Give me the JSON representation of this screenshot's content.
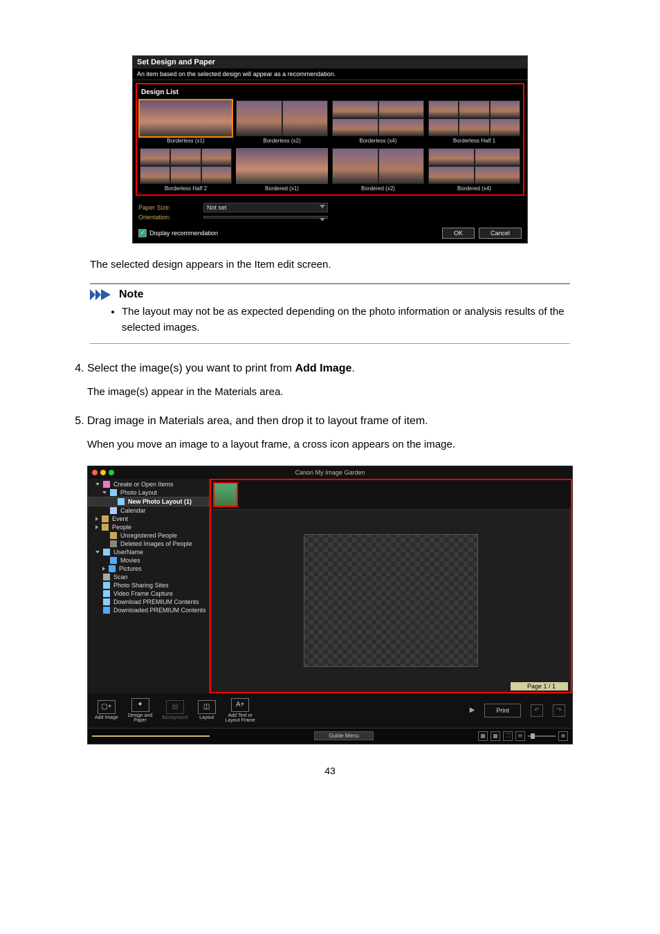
{
  "dialog": {
    "title": "Set Design and Paper",
    "subtitle": "An item based on the selected design will appear as a recommendation.",
    "design_list_header": "Design List",
    "designs": [
      {
        "label": "Borderless (x1)",
        "selected": true,
        "grid": null
      },
      {
        "label": "Borderless (x2)",
        "selected": false,
        "grid": "g2x1"
      },
      {
        "label": "Borderless (x4)",
        "selected": false,
        "grid": "g2x2"
      },
      {
        "label": "Borderless Half 1",
        "selected": false,
        "grid": "g3x2"
      },
      {
        "label": "Borderless Half 2",
        "selected": false,
        "grid": "g3x2"
      },
      {
        "label": "Bordered (x1)",
        "selected": false,
        "grid": null
      },
      {
        "label": "Bordered (x2)",
        "selected": false,
        "grid": "g2x1"
      },
      {
        "label": "Bordered (x4)",
        "selected": false,
        "grid": "g2x2"
      }
    ],
    "paper_size_label": "Paper Size:",
    "paper_size_value": "Not set",
    "orientation_label": "Orientation:",
    "orientation_value": "",
    "display_recommendation": "Display recommendation",
    "ok": "OK",
    "cancel": "Cancel"
  },
  "instructions": {
    "after_dialog": "The selected design appears in the Item edit screen.",
    "note_heading": "Note",
    "note_bullet": "The layout may not be as expected depending on the photo information or analysis results of the selected images.",
    "step4_pre": "Select the image(s) you want to print from ",
    "step4_bold": "Add Image",
    "step4_post": ".",
    "step4_sub": "The image(s) appear in the Materials area.",
    "step5": "Drag image in Materials area, and then drop it to layout frame of item.",
    "step5_sub": "When you move an image to a layout frame, a cross icon appears on the image."
  },
  "app": {
    "title": "Canon My Image Garden",
    "page_indicator": "Page 1 / 1",
    "sidebar": [
      {
        "label": "Create or Open Items",
        "indent": 0,
        "icon": "brush",
        "caret": "open"
      },
      {
        "label": "Photo Layout",
        "indent": 1,
        "icon": "grid",
        "caret": "open"
      },
      {
        "label": "New Photo Layout (1)",
        "indent": 2,
        "icon": "grid",
        "selected": true
      },
      {
        "label": "Calendar",
        "indent": 1,
        "icon": "calendar"
      },
      {
        "label": "Event",
        "indent": 0,
        "icon": "clock",
        "caret": "closed"
      },
      {
        "label": "People",
        "indent": 0,
        "icon": "person",
        "caret": "closed"
      },
      {
        "label": "Unregistered People",
        "indent": 1,
        "icon": "person"
      },
      {
        "label": "Deleted Images of People",
        "indent": 1,
        "icon": "person-x"
      },
      {
        "label": "UserName",
        "indent": 0,
        "icon": "computer",
        "caret": "open"
      },
      {
        "label": "Movies",
        "indent": 1,
        "icon": "folder"
      },
      {
        "label": "Pictures",
        "indent": 1,
        "icon": "folder",
        "caret": "closed"
      },
      {
        "label": "Scan",
        "indent": 0,
        "icon": "scanner"
      },
      {
        "label": "Photo Sharing Sites",
        "indent": 0,
        "icon": "share"
      },
      {
        "label": "Video Frame Capture",
        "indent": 0,
        "icon": "video"
      },
      {
        "label": "Download PREMIUM Contents",
        "indent": 0,
        "icon": "download"
      },
      {
        "label": "Downloaded PREMIUM Contents",
        "indent": 0,
        "icon": "folder"
      }
    ],
    "toolbar": [
      {
        "label": "Add Image",
        "icon": "image-plus",
        "enabled": true
      },
      {
        "label": "Design and Paper",
        "icon": "design",
        "enabled": true
      },
      {
        "label": "Background",
        "icon": "bg",
        "enabled": false
      },
      {
        "label": "Layout",
        "icon": "layout",
        "enabled": true
      },
      {
        "label": "Add Text or Layout Frame",
        "icon": "text-frame",
        "enabled": true
      }
    ],
    "print_label": "Print",
    "guide_menu": "Guide Menu"
  },
  "page_number": "43"
}
